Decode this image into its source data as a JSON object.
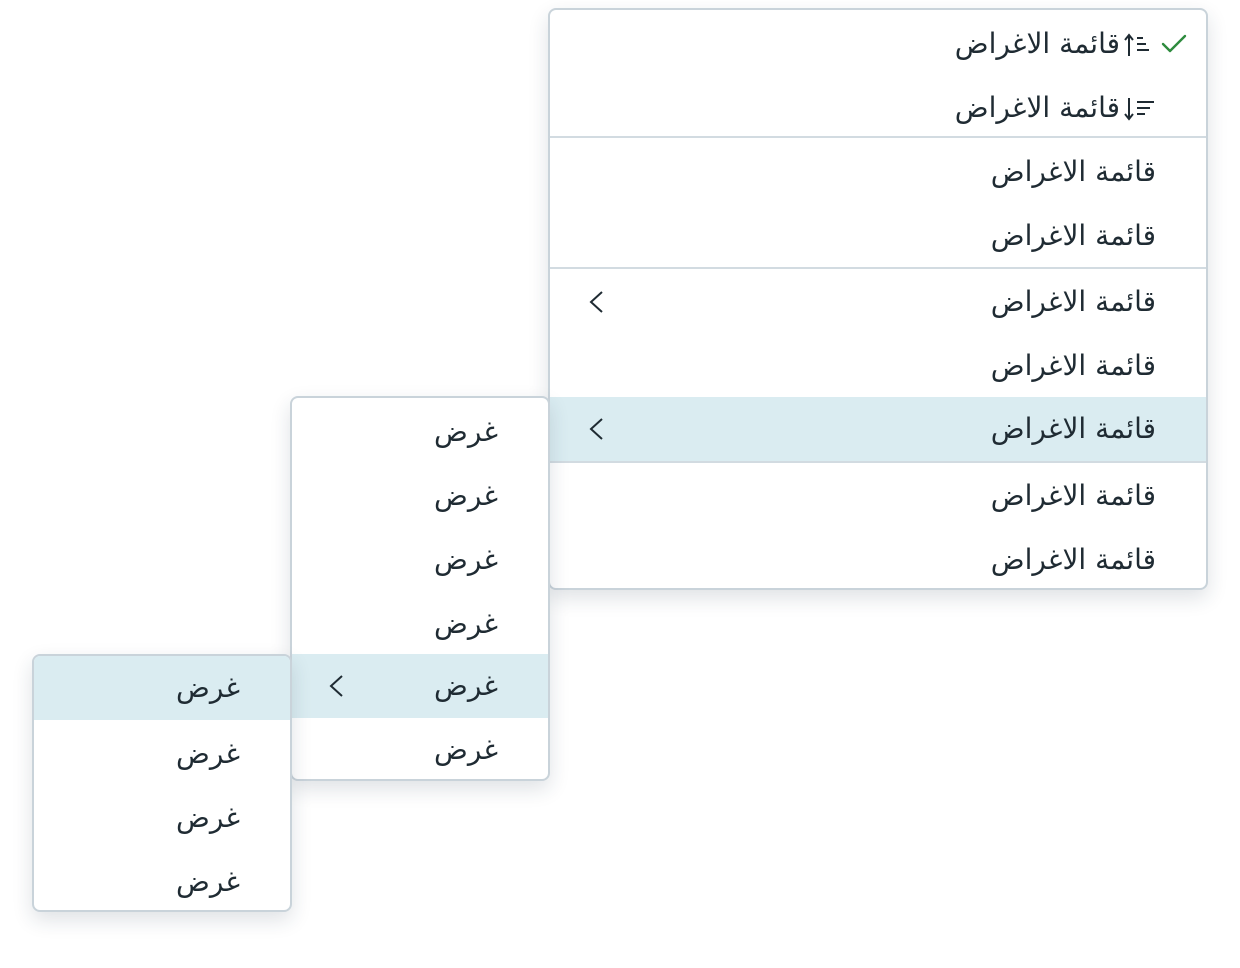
{
  "main_menu": {
    "sort_items": [
      {
        "label": "قائمة الاغراض",
        "icon": "sort-ascending-icon",
        "checked": true
      },
      {
        "label": "قائمة الاغراض",
        "icon": "sort-descending-icon",
        "checked": false
      }
    ],
    "group_two": [
      {
        "label": "قائمة الاغراض"
      },
      {
        "label": "قائمة الاغراض"
      }
    ],
    "group_three": [
      {
        "label": "قائمة الاغراض",
        "has_submenu": true
      },
      {
        "label": "قائمة الاغراض",
        "has_submenu": false
      },
      {
        "label": "قائمة الاغراض",
        "has_submenu": true,
        "active": true
      }
    ],
    "group_four": [
      {
        "label": "قائمة الاغراض"
      },
      {
        "label": "قائمة الاغراض"
      }
    ]
  },
  "submenu_1": {
    "items": [
      {
        "label": "غرض"
      },
      {
        "label": "غرض"
      },
      {
        "label": "غرض"
      },
      {
        "label": "غرض"
      },
      {
        "label": "غرض",
        "has_submenu": true,
        "active": true
      },
      {
        "label": "غرض"
      }
    ]
  },
  "submenu_2": {
    "items": [
      {
        "label": "غرض",
        "active": true
      },
      {
        "label": "غرض"
      },
      {
        "label": "غرض"
      },
      {
        "label": "غرض"
      }
    ]
  },
  "colors": {
    "active_background": "#daecf1",
    "check_color": "#2e8b3e",
    "text_color": "#1f2b33",
    "border_color": "#c9d3da"
  }
}
